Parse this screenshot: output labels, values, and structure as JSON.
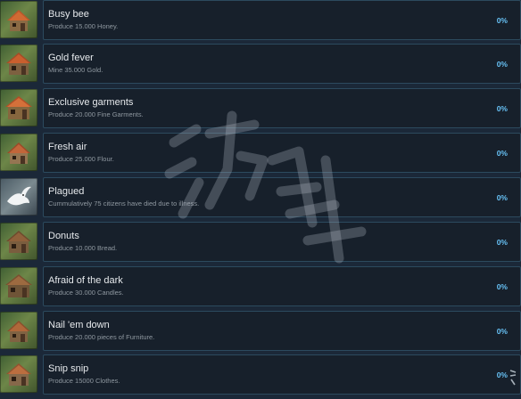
{
  "achievements": [
    {
      "title": "Busy bee",
      "description": "Produce 15.000 Honey.",
      "percent": "0%",
      "icon": "house-icon"
    },
    {
      "title": "Gold fever",
      "description": "Mine 35.000 Gold.",
      "percent": "0%",
      "icon": "house-icon"
    },
    {
      "title": "Exclusive garments",
      "description": "Produce 20.000 Fine Garments.",
      "percent": "0%",
      "icon": "house-icon"
    },
    {
      "title": "Fresh air",
      "description": "Produce 25.000 Flour.",
      "percent": "0%",
      "icon": "house-icon"
    },
    {
      "title": "Plagued",
      "description": "Cummulatively 75 citizens have died due to illness.",
      "percent": "0%",
      "icon": "dove-icon"
    },
    {
      "title": "Donuts",
      "description": "Produce 10.000 Bread.",
      "percent": "0%",
      "icon": "house-icon"
    },
    {
      "title": "Afraid of the dark",
      "description": "Produce 30.000 Candles.",
      "percent": "0%",
      "icon": "house-icon"
    },
    {
      "title": "Nail 'em down",
      "description": "Produce 20.000 pieces of Furniture.",
      "percent": "0%",
      "icon": "house-icon"
    },
    {
      "title": "Snip snip",
      "description": "Produce 15000 Clothes.",
      "percent": "0%",
      "icon": "house-icon"
    }
  ],
  "colors": {
    "background": "#1b2838",
    "card": "#17202b",
    "card_border": "#2c4a5e",
    "title": "#e6e9ec",
    "description": "#8f98a0",
    "percent": "#67c1f5"
  }
}
